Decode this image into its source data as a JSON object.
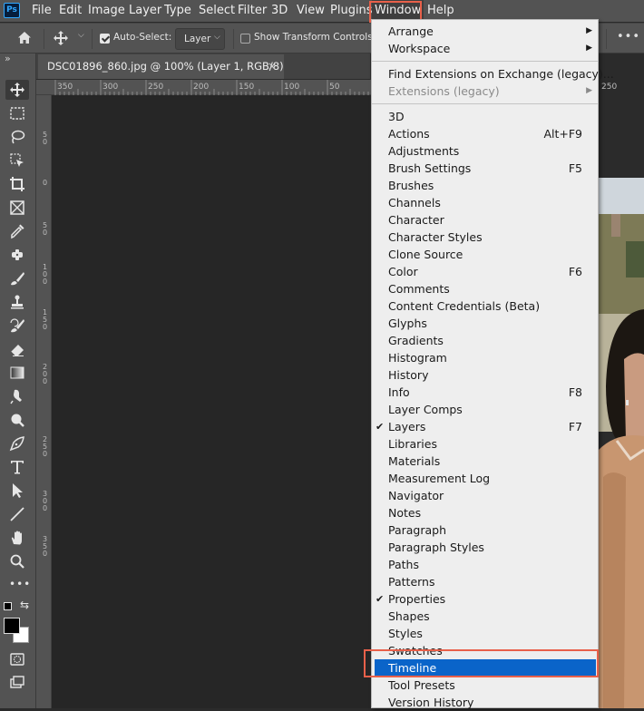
{
  "app": {
    "logo": "Ps"
  },
  "menubar": {
    "items": [
      "File",
      "Edit",
      "Image",
      "Layer",
      "Type",
      "Select",
      "Filter",
      "3D",
      "View",
      "Plugins",
      "Window",
      "Help"
    ]
  },
  "options_bar": {
    "auto_select_label": "Auto-Select:",
    "auto_select_checked": true,
    "target_select_value": "Layer",
    "show_transform_label": "Show Transform Controls",
    "show_transform_checked": false,
    "more_label": "•••"
  },
  "toolbar": {
    "collapse_label": "»",
    "more_tools_label": "•••",
    "foreground_color": "#000000",
    "background_color": "#ffffff"
  },
  "document": {
    "tab_title": "DSC01896_860.jpg @ 100% (Layer 1, RGB/8) *",
    "close_label": "×",
    "ruler_top_ticks": [
      "350",
      "300",
      "250",
      "200",
      "150",
      "100",
      "50",
      "0",
      "250"
    ],
    "ruler_left_ticks": [
      "5\n0",
      "0",
      "5\n0",
      "1\n0\n0",
      "1\n5\n0",
      "2\n0\n0",
      "2\n5\n0",
      "3\n0\n0",
      "3\n5\n0"
    ]
  },
  "window_menu": {
    "items": [
      {
        "label": "Arrange",
        "submenu": true
      },
      {
        "label": "Workspace",
        "submenu": true
      },
      {
        "separator": true
      },
      {
        "label": "Find Extensions on Exchange (legacy)..."
      },
      {
        "label": "Extensions (legacy)",
        "submenu": true,
        "disabled": true
      },
      {
        "separator": true
      },
      {
        "label": "3D"
      },
      {
        "label": "Actions",
        "shortcut": "Alt+F9"
      },
      {
        "label": "Adjustments"
      },
      {
        "label": "Brush Settings",
        "shortcut": "F5"
      },
      {
        "label": "Brushes"
      },
      {
        "label": "Channels"
      },
      {
        "label": "Character"
      },
      {
        "label": "Character Styles"
      },
      {
        "label": "Clone Source"
      },
      {
        "label": "Color",
        "shortcut": "F6"
      },
      {
        "label": "Comments"
      },
      {
        "label": "Content Credentials (Beta)"
      },
      {
        "label": "Glyphs"
      },
      {
        "label": "Gradients"
      },
      {
        "label": "Histogram"
      },
      {
        "label": "History"
      },
      {
        "label": "Info",
        "shortcut": "F8"
      },
      {
        "label": "Layer Comps"
      },
      {
        "label": "Layers",
        "shortcut": "F7",
        "checked": true
      },
      {
        "label": "Libraries"
      },
      {
        "label": "Materials"
      },
      {
        "label": "Measurement Log"
      },
      {
        "label": "Navigator"
      },
      {
        "label": "Notes"
      },
      {
        "label": "Paragraph"
      },
      {
        "label": "Paragraph Styles"
      },
      {
        "label": "Paths"
      },
      {
        "label": "Patterns"
      },
      {
        "label": "Properties",
        "checked": true
      },
      {
        "label": "Shapes"
      },
      {
        "label": "Styles"
      },
      {
        "label": "Swatches"
      },
      {
        "label": "Timeline",
        "selected": true
      },
      {
        "label": "Tool Presets"
      },
      {
        "label": "Version History"
      }
    ]
  },
  "colors": {
    "menu_selection": "#0a64c9",
    "annotation_outline": "#e8604a",
    "panel_gray": "#535353",
    "canvas_dark": "#262626"
  }
}
